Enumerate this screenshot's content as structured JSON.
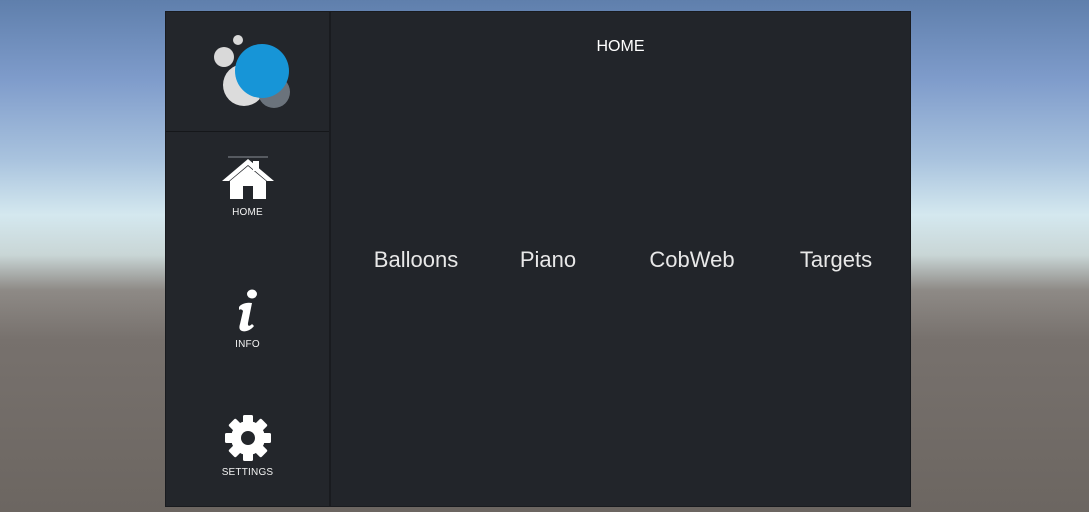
{
  "sidebar": {
    "logo_icon": "bubbles-logo-icon",
    "logo_colors": {
      "blue": "#1795d7",
      "light": "#d9d9d9",
      "grey": "#6b737c"
    },
    "items": [
      {
        "label": "HOME",
        "icon": "home-icon"
      },
      {
        "label": "INFO",
        "icon": "info-icon"
      },
      {
        "label": "SETTINGS",
        "icon": "gear-icon"
      }
    ]
  },
  "main": {
    "title": "HOME",
    "games": [
      {
        "label": "Balloons"
      },
      {
        "label": "Piano"
      },
      {
        "label": "CobWeb"
      },
      {
        "label": "Targets"
      }
    ]
  }
}
